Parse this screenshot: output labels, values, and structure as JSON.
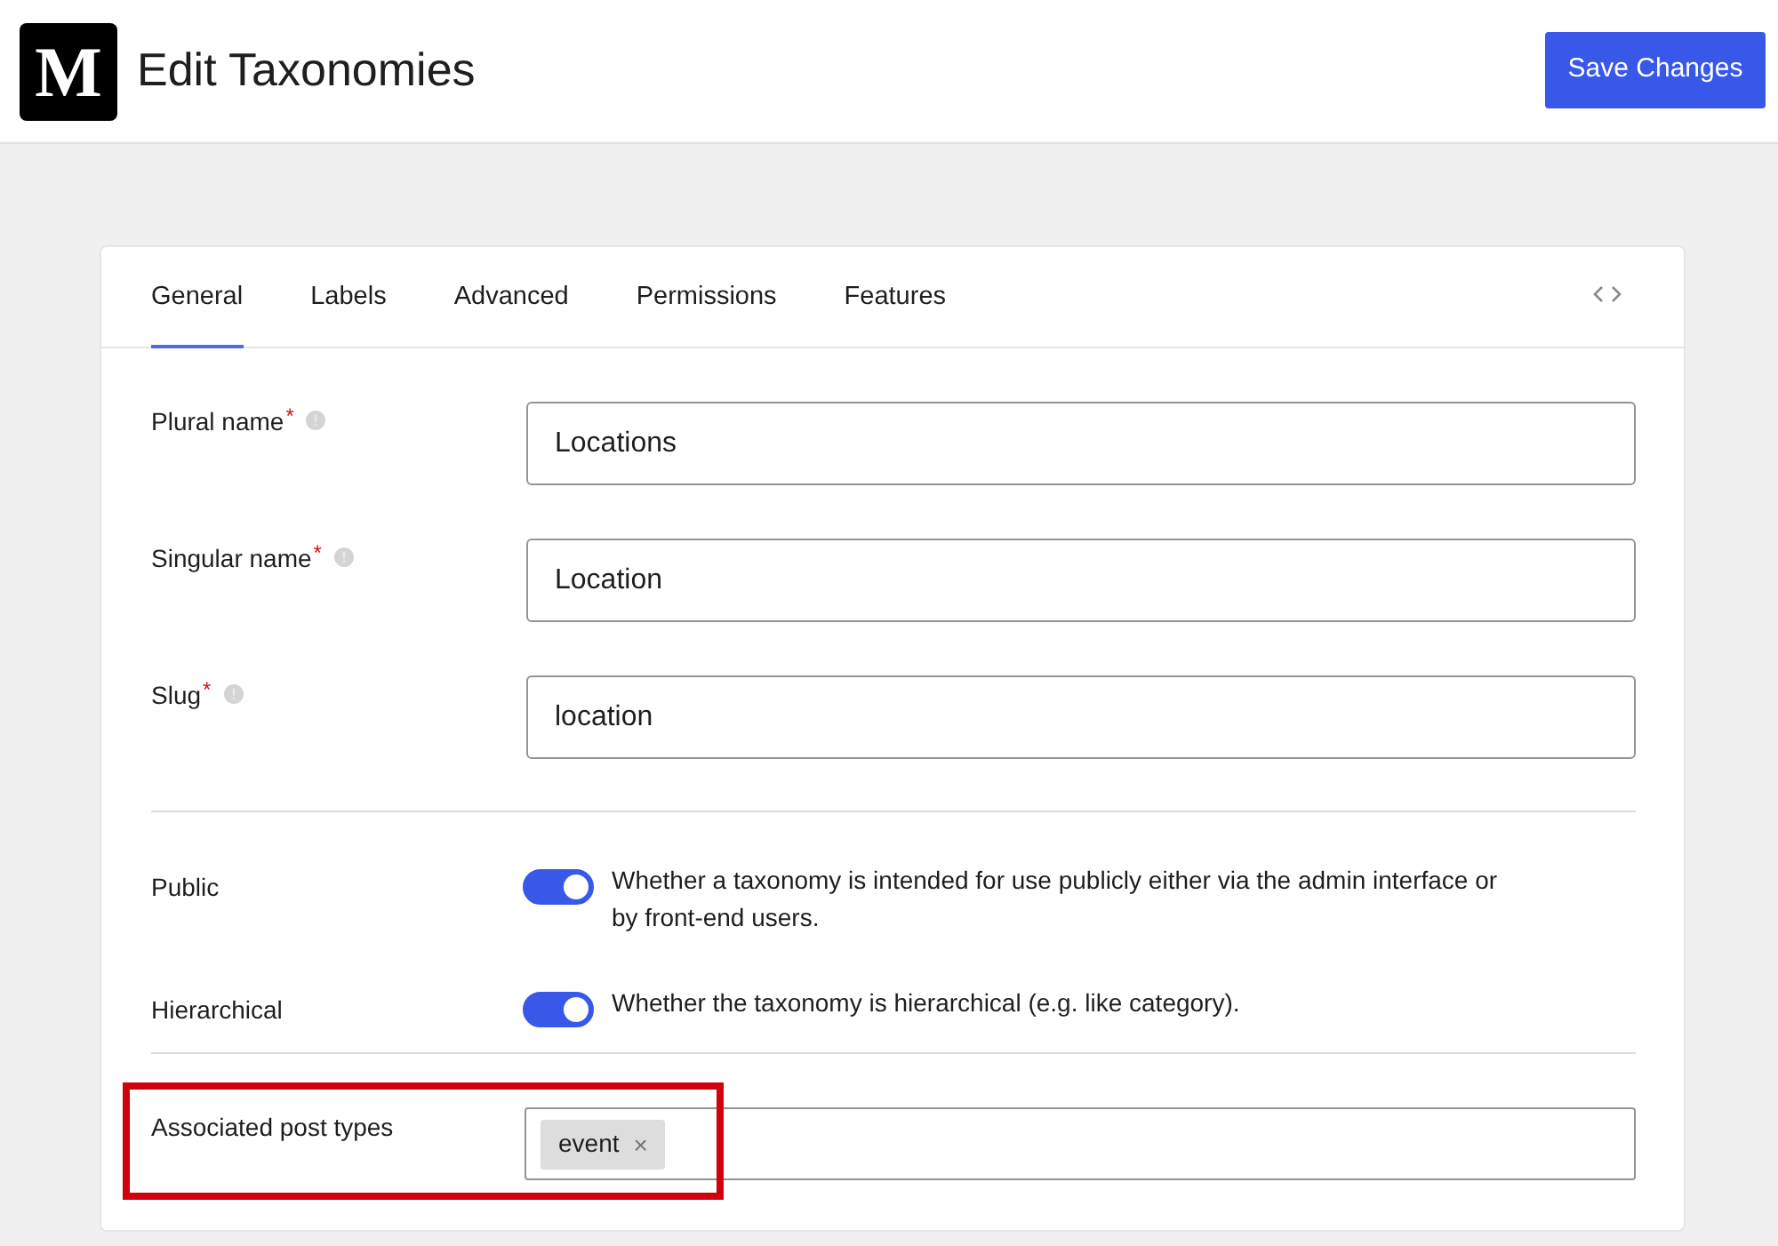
{
  "header": {
    "logo": "M",
    "title": "Edit Taxonomies",
    "save_button": "Save Changes"
  },
  "tabs": [
    {
      "label": "General",
      "selected": true
    },
    {
      "label": "Labels",
      "selected": false
    },
    {
      "label": "Advanced",
      "selected": false
    },
    {
      "label": "Permissions",
      "selected": false
    },
    {
      "label": "Features",
      "selected": false
    }
  ],
  "sections": [
    {
      "fields": [
        {
          "kind": "text",
          "label": "Plural name",
          "required_mark": "*",
          "value": "Locations"
        },
        {
          "kind": "text",
          "label": "Singular name",
          "required_mark": "*",
          "value": "Location"
        },
        {
          "kind": "text",
          "label": "Slug",
          "required_mark": "*",
          "value": "location"
        }
      ]
    },
    {
      "fields": [
        {
          "kind": "toggle",
          "label": "Public",
          "on": true,
          "description": "Whether a taxonomy is intended for use publicly either via the admin interface or by front-end users."
        },
        {
          "kind": "toggle",
          "label": "Hierarchical",
          "on": true,
          "description": "Whether the taxonomy is hierarchical (e.g. like category)."
        }
      ]
    },
    {
      "fields": [
        {
          "kind": "tags",
          "label": "Associated post types",
          "highlighted": true,
          "tags": [
            {
              "label": "event",
              "remove": "×"
            }
          ]
        }
      ]
    }
  ]
}
